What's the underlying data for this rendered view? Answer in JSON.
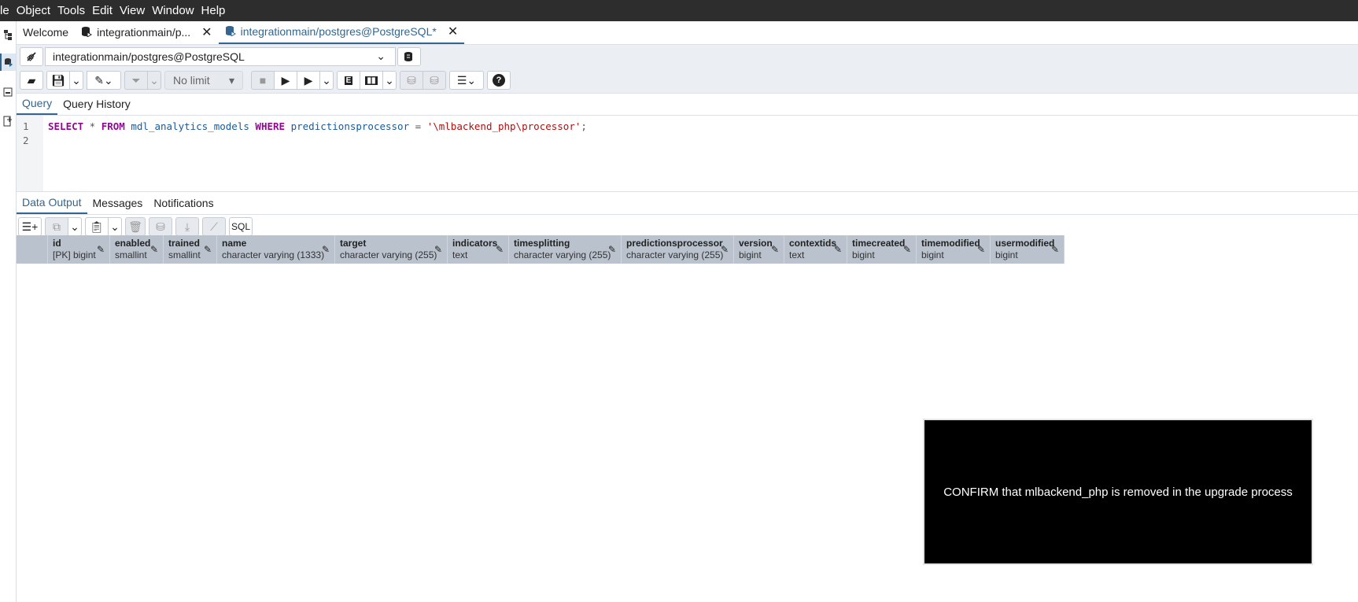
{
  "menu": [
    "le",
    "Object",
    "Tools",
    "Edit",
    "View",
    "Window",
    "Help"
  ],
  "tabs": {
    "welcome": "Welcome",
    "tab1": "integrationmain/p...",
    "tab2": "integrationmain/postgres@PostgreSQL*"
  },
  "connection": {
    "label": "integrationmain/postgres@PostgreSQL"
  },
  "toolbar": {
    "limit": "No limit"
  },
  "query_tabs": {
    "query": "Query",
    "history": "Query History"
  },
  "editor": {
    "line1": "1",
    "line2": "2",
    "kw_select": "SELECT",
    "star": " * ",
    "kw_from": "FROM",
    "table": " mdl_analytics_models ",
    "kw_where": "WHERE",
    "column": " predictionsprocessor ",
    "eq": "= ",
    "value": "'\\mlbackend_php\\processor'",
    "semi": ";"
  },
  "output_tabs": {
    "data": "Data Output",
    "messages": "Messages",
    "notifications": "Notifications"
  },
  "sql_button": "SQL",
  "columns": [
    {
      "name": "id",
      "type": "[PK] bigint"
    },
    {
      "name": "enabled",
      "type": "smallint"
    },
    {
      "name": "trained",
      "type": "smallint"
    },
    {
      "name": "name",
      "type": "character varying (1333)"
    },
    {
      "name": "target",
      "type": "character varying (255)"
    },
    {
      "name": "indicators",
      "type": "text"
    },
    {
      "name": "timesplitting",
      "type": "character varying (255)"
    },
    {
      "name": "predictionsprocessor",
      "type": "character varying (255)"
    },
    {
      "name": "version",
      "type": "bigint"
    },
    {
      "name": "contextids",
      "type": "text"
    },
    {
      "name": "timecreated",
      "type": "bigint"
    },
    {
      "name": "timemodified",
      "type": "bigint"
    },
    {
      "name": "usermodified",
      "type": "bigint"
    }
  ],
  "overlay": {
    "text": "CONFIRM that mlbackend_php is removed in the upgrade process"
  }
}
